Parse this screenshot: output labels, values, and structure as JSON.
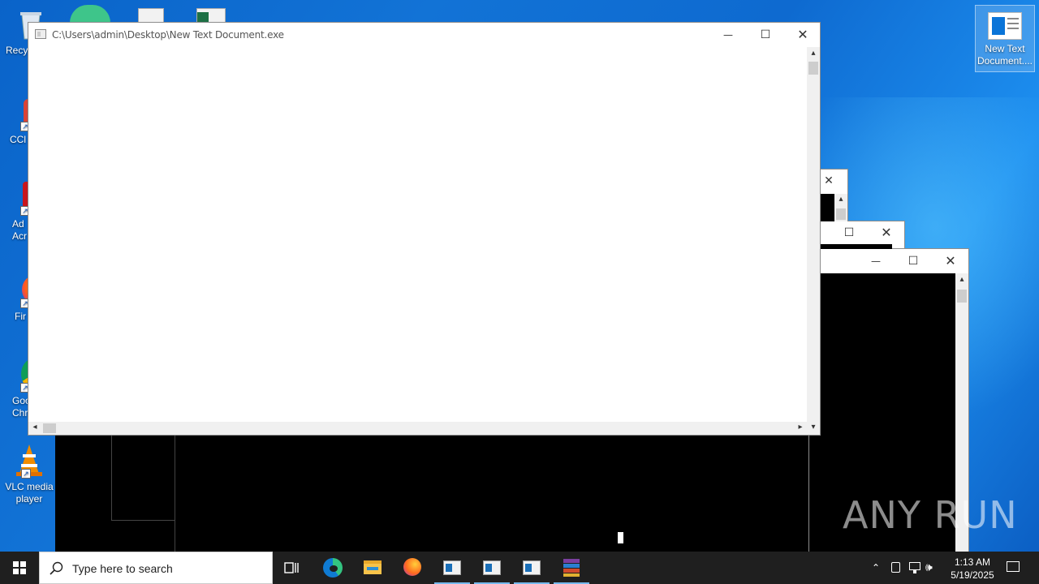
{
  "desktop": {
    "icons_left": [
      {
        "label": "Recy",
        "icon": "recycle-bin-icon"
      },
      {
        "label": "CCl",
        "icon": "ccleaner-icon"
      },
      {
        "label": "Ad Acr",
        "icon": "adobe-acrobat-icon"
      },
      {
        "label": "Fir",
        "icon": "firefox-icon"
      },
      {
        "label": "Goo Chr",
        "icon": "chrome-icon"
      },
      {
        "label": "VLC media player",
        "icon": "vlc-icon"
      }
    ],
    "icon_right": {
      "label_line1": "New Text",
      "label_line2": "Document....",
      "icon": "exe-window-icon"
    }
  },
  "main_window": {
    "title": "C:\\Users\\admin\\Desktop\\New Text Document.exe",
    "minimize": "—",
    "maximize": "☐",
    "close": "✕"
  },
  "back_windows": [
    {
      "close": "✕"
    },
    {
      "maximize": "☐",
      "close": "✕"
    },
    {
      "minimize": "—",
      "maximize": "☐",
      "close": "✕"
    }
  ],
  "taskbar": {
    "search_placeholder": "Type here to search",
    "apps": [
      "task-view-icon",
      "edge-icon",
      "file-explorer-icon",
      "firefox-icon",
      "console-window-icon",
      "console-window-icon",
      "console-window-icon",
      "winrar-icon"
    ],
    "time": "1:13 AM",
    "date": "5/19/2025"
  },
  "watermark": "ANY RUN",
  "colors": {
    "desktop": "#0e6ad0",
    "taskbar": "#1f1f1f",
    "accent": "#76b9ed"
  }
}
